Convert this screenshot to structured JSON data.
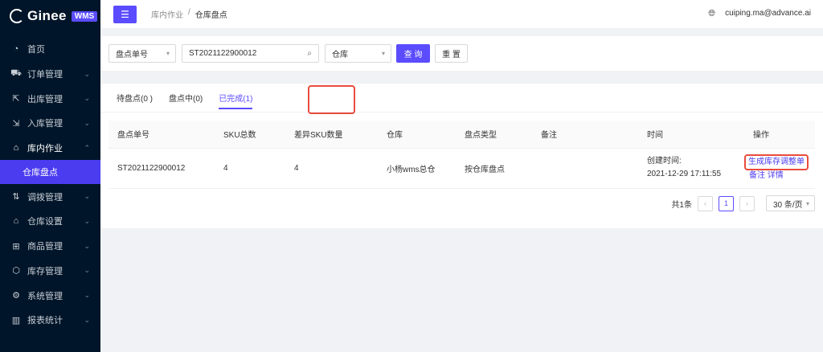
{
  "brand": {
    "name": "Ginee",
    "badge": "WMS"
  },
  "sidebar": {
    "items": [
      {
        "label": "首页",
        "icon": "dashboard-icon",
        "glyph": "◔",
        "arrow": ""
      },
      {
        "label": "订单管理",
        "icon": "cart-icon",
        "glyph": "⛟",
        "arrow": "⌄"
      },
      {
        "label": "出库管理",
        "icon": "outbound-icon",
        "glyph": "⇱",
        "arrow": "⌄"
      },
      {
        "label": "入库管理",
        "icon": "inbound-icon",
        "glyph": "⇲",
        "arrow": "⌄"
      },
      {
        "label": "库内作业",
        "icon": "warehouse-task-icon",
        "glyph": "⌂",
        "arrow": "⌃"
      }
    ],
    "active_sub": "仓库盘点",
    "items_after": [
      {
        "label": "调拨管理",
        "icon": "transfer-icon",
        "glyph": "⇅",
        "arrow": "⌄"
      },
      {
        "label": "仓库设置",
        "icon": "warehouse-settings-icon",
        "glyph": "⌂",
        "arrow": "⌄"
      },
      {
        "label": "商品管理",
        "icon": "product-icon",
        "glyph": "⊞",
        "arrow": "⌄"
      },
      {
        "label": "库存管理",
        "icon": "inventory-icon",
        "glyph": "⬡",
        "arrow": "⌄"
      },
      {
        "label": "系统管理",
        "icon": "settings-icon",
        "glyph": "⚙",
        "arrow": "⌄"
      },
      {
        "label": "报表统计",
        "icon": "report-icon",
        "glyph": "▥",
        "arrow": "⌄"
      }
    ]
  },
  "header": {
    "breadcrumb": [
      "库内作业",
      "仓库盘点"
    ],
    "separator": "/",
    "user": "cuiping.ma@advance.ai"
  },
  "filter": {
    "field_select": "盘点单号",
    "search_value": "ST2021122900012",
    "warehouse_placeholder": "仓库",
    "search_button": "查 询",
    "reset_button": "重 置"
  },
  "tabs": [
    {
      "label": "待盘点(0 )",
      "active": false
    },
    {
      "label": "盘点中(0)",
      "active": false
    },
    {
      "label": "已完成(1)",
      "active": true
    }
  ],
  "table": {
    "columns": [
      "盘点单号",
      "SKU总数",
      "差异SKU数量",
      "仓库",
      "盘点类型",
      "备注",
      "时间",
      "操作"
    ],
    "rows": [
      {
        "order_no": "ST2021122900012",
        "sku_total": "4",
        "sku_diff": "4",
        "warehouse": "小杨wms总仓",
        "type": "按仓库盘点",
        "remark": "",
        "time_label": "创建时间:",
        "time_value": "2021-12-29 17:11:55",
        "action_primary": "生成库存调整单",
        "action_remark": "备注",
        "action_detail": "详情"
      }
    ]
  },
  "pagination": {
    "total_text": "共1条",
    "prev": "‹",
    "current_page": "1",
    "next": "›",
    "page_size": "30 条/页"
  },
  "colors": {
    "primary": "#5b4cff",
    "sidebar_bg": "#001529",
    "highlight": "#e84c3d"
  }
}
